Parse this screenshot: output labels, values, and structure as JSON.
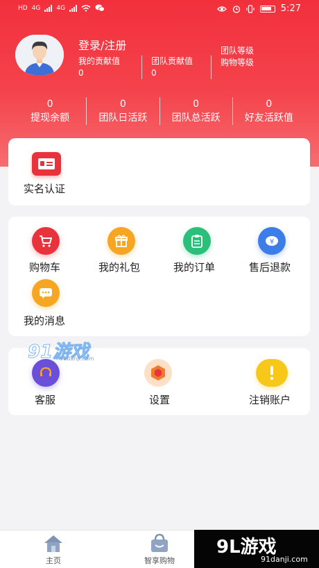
{
  "statusbar": {
    "left": [
      "HD",
      "4G",
      "4G"
    ],
    "time": "5:27"
  },
  "profile": {
    "login_label": "登录/注册",
    "contribution_label": "我的贡献值",
    "contribution_value": "0",
    "team_contribution_label": "团队贡献值",
    "team_contribution_value": "0",
    "team_level_label": "团队等级",
    "shopping_level_label": "购物等级"
  },
  "metrics": [
    {
      "value": "0",
      "label": "提现余额"
    },
    {
      "value": "0",
      "label": "团队日活跃"
    },
    {
      "value": "0",
      "label": "团队总活跃"
    },
    {
      "value": "0",
      "label": "好友活跃值"
    }
  ],
  "verify": {
    "label": "实名认证"
  },
  "orders": {
    "items": [
      {
        "label": "购物车",
        "icon": "cart-icon",
        "color": "#e8333c"
      },
      {
        "label": "我的礼包",
        "icon": "gift-icon",
        "color": "#f6a623"
      },
      {
        "label": "我的订单",
        "icon": "order-icon",
        "color": "#2bbf7a"
      },
      {
        "label": "售后退款",
        "icon": "refund-icon",
        "color": "#3c7de8"
      },
      {
        "label": "我的消息",
        "icon": "message-icon",
        "color": "#f6a623"
      }
    ]
  },
  "service": {
    "items": [
      {
        "label": "客服",
        "icon": "service-icon",
        "color": "#6b4fd8"
      },
      {
        "label": "设置",
        "icon": "settings-icon",
        "color": "#f07a2e"
      },
      {
        "label": "注销账户",
        "icon": "exclamation-icon",
        "color": "#f7c81a"
      }
    ]
  },
  "tabbar": {
    "home_label": "主页",
    "shop_label": "智享购物"
  },
  "watermark": {
    "small_text": "91游戏",
    "small_url": "91danji.com",
    "big_text": "9L游戏",
    "big_url": "91danji.com"
  }
}
